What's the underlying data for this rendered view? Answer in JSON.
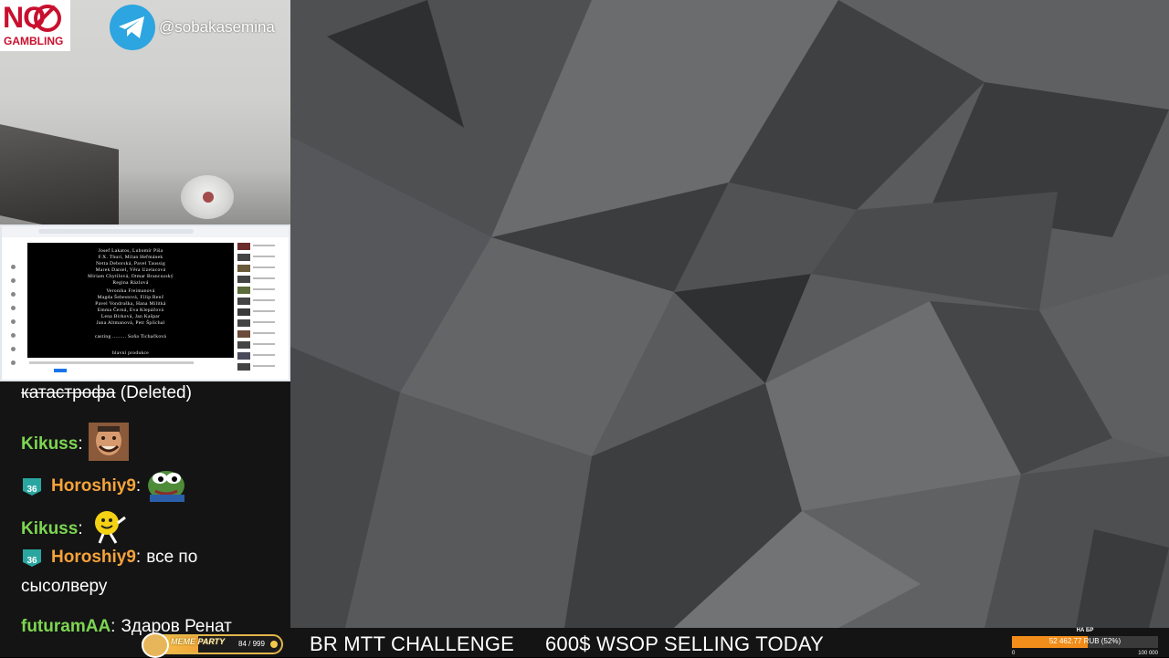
{
  "overlay": {
    "no_gambling": {
      "top": "NO",
      "bottom": "GAMBLING"
    },
    "telegram_handle": "@sobakasemina"
  },
  "capture": {
    "credits": [
      "Josef Lakatos, Lubomír Piša",
      "F.X. Thuri, Milan Heřmánek",
      "Nettа Deborská, Pavel Taussig",
      "Marek Daniel, Věra Uzelacová",
      "Miriam Chytilová, Otmar Brancuzský",
      "Regina Rázlová",
      "Veronika Freimanová",
      "Magda Šebestová, Filip Renč",
      "Pavel Vondruška, Hana Militká",
      "Emma Černá, Eva Klepáčová",
      "Lena Birková, Jan Kašpar",
      "Jana Altmanová, Petr Šplíchal",
      "casting ......... Soňa Tichačková",
      "hlavní produkce"
    ]
  },
  "chat": {
    "messages": [
      {
        "user": "",
        "text": "катастрофа",
        "suffix": " (Deleted)",
        "badge": "",
        "user_color": "#ffffff"
      },
      {
        "user": "Kikuss",
        "text": "",
        "badge": "",
        "emote": "meme-face-emote",
        "user_color": "#7dd651"
      },
      {
        "user": "Horoshiy9",
        "text": "",
        "badge": "36",
        "emote": "pepe-emote",
        "user_color": "#f7a33a"
      },
      {
        "user": "Kikuss",
        "text": "",
        "badge": "",
        "emote": "dancing-mm-emote",
        "user_color": "#7dd651"
      },
      {
        "user": "Horoshiy9",
        "text": "все по",
        "text2": "сысолверу",
        "badge": "36",
        "user_color": "#f7a33a"
      },
      {
        "user": "futuramAA",
        "text": "Здаров Ренат",
        "badge": "",
        "user_color": "#7dd651"
      }
    ],
    "colon": ":"
  },
  "meme_party": {
    "label": "MEME PARTY",
    "count": "84 / 999"
  },
  "ticker": {
    "item1": "BR MTT CHALLENGE",
    "item2": "600$ WSOP SELLING TODAY"
  },
  "goal": {
    "title": "НА БР",
    "text": "52 462.77 RUB (52%)",
    "progress_percent": 52,
    "min": "0",
    "max": "100 000"
  },
  "colors": {
    "background": "#5a5b5d",
    "goal_fill": "#f28c1a",
    "badge_teal": "#2aa6a0",
    "telegram": "#2ca5e0"
  }
}
